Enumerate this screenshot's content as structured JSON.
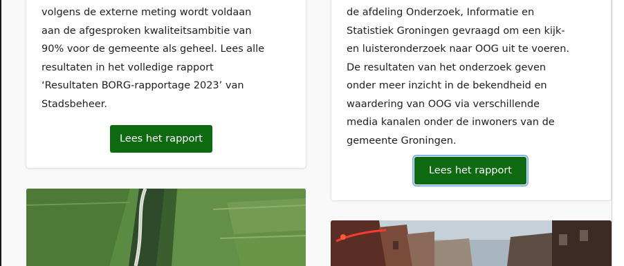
{
  "left_card": {
    "lines": [
      "volgens de externe meting wordt voldaan",
      "aan de afgesproken kwaliteitsambitie van",
      "90% voor de gemeente als geheel. Lees alle",
      "resultaten in het volledige rapport",
      "‘Resultaten BORG-rapportage 2023’ van",
      "Stadsbeheer."
    ],
    "button_label": "Lees het rapport"
  },
  "right_card": {
    "lines": [
      "de afdeling Onderzoek, Informatie en",
      "Statistiek Groningen gevraagd om een kijk-",
      "en luisteronderzoek naar OOG uit te voeren.",
      "De resultaten van het onderzoek geven",
      "onder meer inzicht in de bekendheid en",
      "waardering van OOG via verschillende",
      "media kanalen onder de inwoners van de",
      "gemeente Groningen."
    ],
    "button_label": "Lees het rapport"
  },
  "colors": {
    "button_green": "#0d6a10",
    "focus_ring": "#7fb6e6"
  },
  "images": {
    "left": "aerial-farmland-canal-photo",
    "right": "city-street-buildings-photo"
  }
}
